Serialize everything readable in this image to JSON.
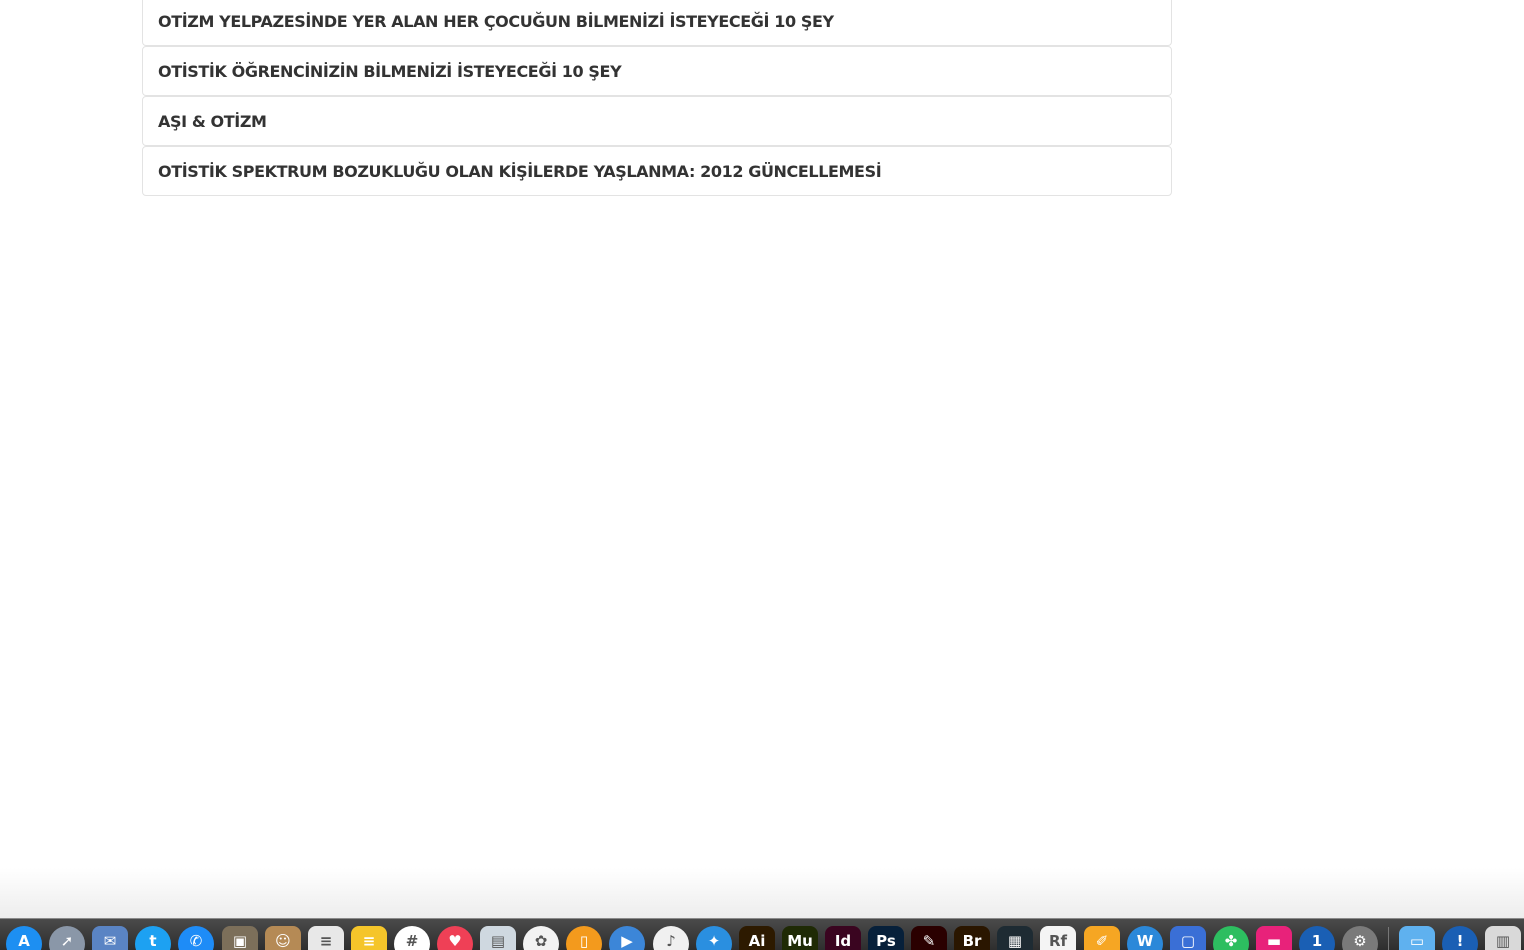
{
  "articles": [
    {
      "title": "OTİZM YELPAZESİNDE YER ALAN HER ÇOCUĞUN BİLMENİZİ İSTEYECEĞİ 10 ŞEY"
    },
    {
      "title": "OTİSTİK ÖĞRENCİNİZİN BİLMENİZİ İSTEYECEĞİ 10 ŞEY"
    },
    {
      "title": "AŞI & OTİZM"
    },
    {
      "title": "OTİSTİK SPEKTRUM BOZUKLUĞU OLAN KİŞİLERDE YAŞLANMA: 2012 GÜNCELLEMESİ"
    }
  ],
  "dock": {
    "icons": [
      {
        "name": "app-store-icon",
        "color": "#1d8ff2",
        "glyph": "A"
      },
      {
        "name": "launchpad-icon",
        "color": "#8a97a8",
        "glyph": "➚"
      },
      {
        "name": "mail-icon",
        "color": "#5a84c4",
        "glyph": "✉"
      },
      {
        "name": "twitter-icon",
        "color": "#1da1f2",
        "glyph": "t"
      },
      {
        "name": "messenger-icon",
        "color": "#1e8cf7",
        "glyph": "✆"
      },
      {
        "name": "archive-icon",
        "color": "#7c6f5a",
        "glyph": "▣"
      },
      {
        "name": "contacts-icon",
        "color": "#b58a55",
        "glyph": "☺"
      },
      {
        "name": "textedit-icon",
        "color": "#e8e8e8",
        "glyph": "≡"
      },
      {
        "name": "notes-icon",
        "color": "#f5c52a",
        "glyph": "≡"
      },
      {
        "name": "slack-icon",
        "color": "#ffffff",
        "glyph": "#"
      },
      {
        "name": "pocket-icon",
        "color": "#ef4056",
        "glyph": "♥"
      },
      {
        "name": "preview-icon",
        "color": "#cfd8e0",
        "glyph": "▤"
      },
      {
        "name": "photos-icon",
        "color": "#f2f2f2",
        "glyph": "✿"
      },
      {
        "name": "ibooks-icon",
        "color": "#f39a1d",
        "glyph": "▯"
      },
      {
        "name": "quicktime-icon",
        "color": "#3c86d8",
        "glyph": "▶"
      },
      {
        "name": "itunes-icon",
        "color": "#f0f0f0",
        "glyph": "♪"
      },
      {
        "name": "safari-icon",
        "color": "#2a8fe0",
        "glyph": "✦"
      },
      {
        "name": "illustrator-icon",
        "color": "#2d1a00",
        "glyph": "Ai"
      },
      {
        "name": "muse-icon",
        "color": "#1f2a05",
        "glyph": "Mu"
      },
      {
        "name": "indesign-icon",
        "color": "#3a0520",
        "glyph": "Id"
      },
      {
        "name": "photoshop-icon",
        "color": "#07203a",
        "glyph": "Ps"
      },
      {
        "name": "acrobat-icon",
        "color": "#2a0000",
        "glyph": "✎"
      },
      {
        "name": "bridge-icon",
        "color": "#2a1600",
        "glyph": "Br"
      },
      {
        "name": "coda-icon",
        "color": "#1e2b33",
        "glyph": "▦"
      },
      {
        "name": "rf-app-icon",
        "color": "#f4f4f4",
        "glyph": "Rf"
      },
      {
        "name": "pages-icon",
        "color": "#f6a623",
        "glyph": "✐"
      },
      {
        "name": "wunderlist-icon",
        "color": "#2b88d9",
        "glyph": "W"
      },
      {
        "name": "keynote-icon",
        "color": "#3a6fd6",
        "glyph": "▢"
      },
      {
        "name": "evernote-icon",
        "color": "#2dbe60",
        "glyph": "✤"
      },
      {
        "name": "folder-pink-icon",
        "color": "#e8227a",
        "glyph": "▬"
      },
      {
        "name": "1password-icon",
        "color": "#1a5fb4",
        "glyph": "1"
      },
      {
        "name": "system-preferences-icon",
        "color": "#7a7a7a",
        "glyph": "⚙"
      },
      {
        "name": "downloads-folder-icon",
        "color": "#5fb1ef",
        "glyph": "▭"
      },
      {
        "name": "1password-mini-icon",
        "color": "#1a5fb4",
        "glyph": "!"
      },
      {
        "name": "trash-icon",
        "color": "#d9d9d9",
        "glyph": "▥"
      }
    ]
  }
}
